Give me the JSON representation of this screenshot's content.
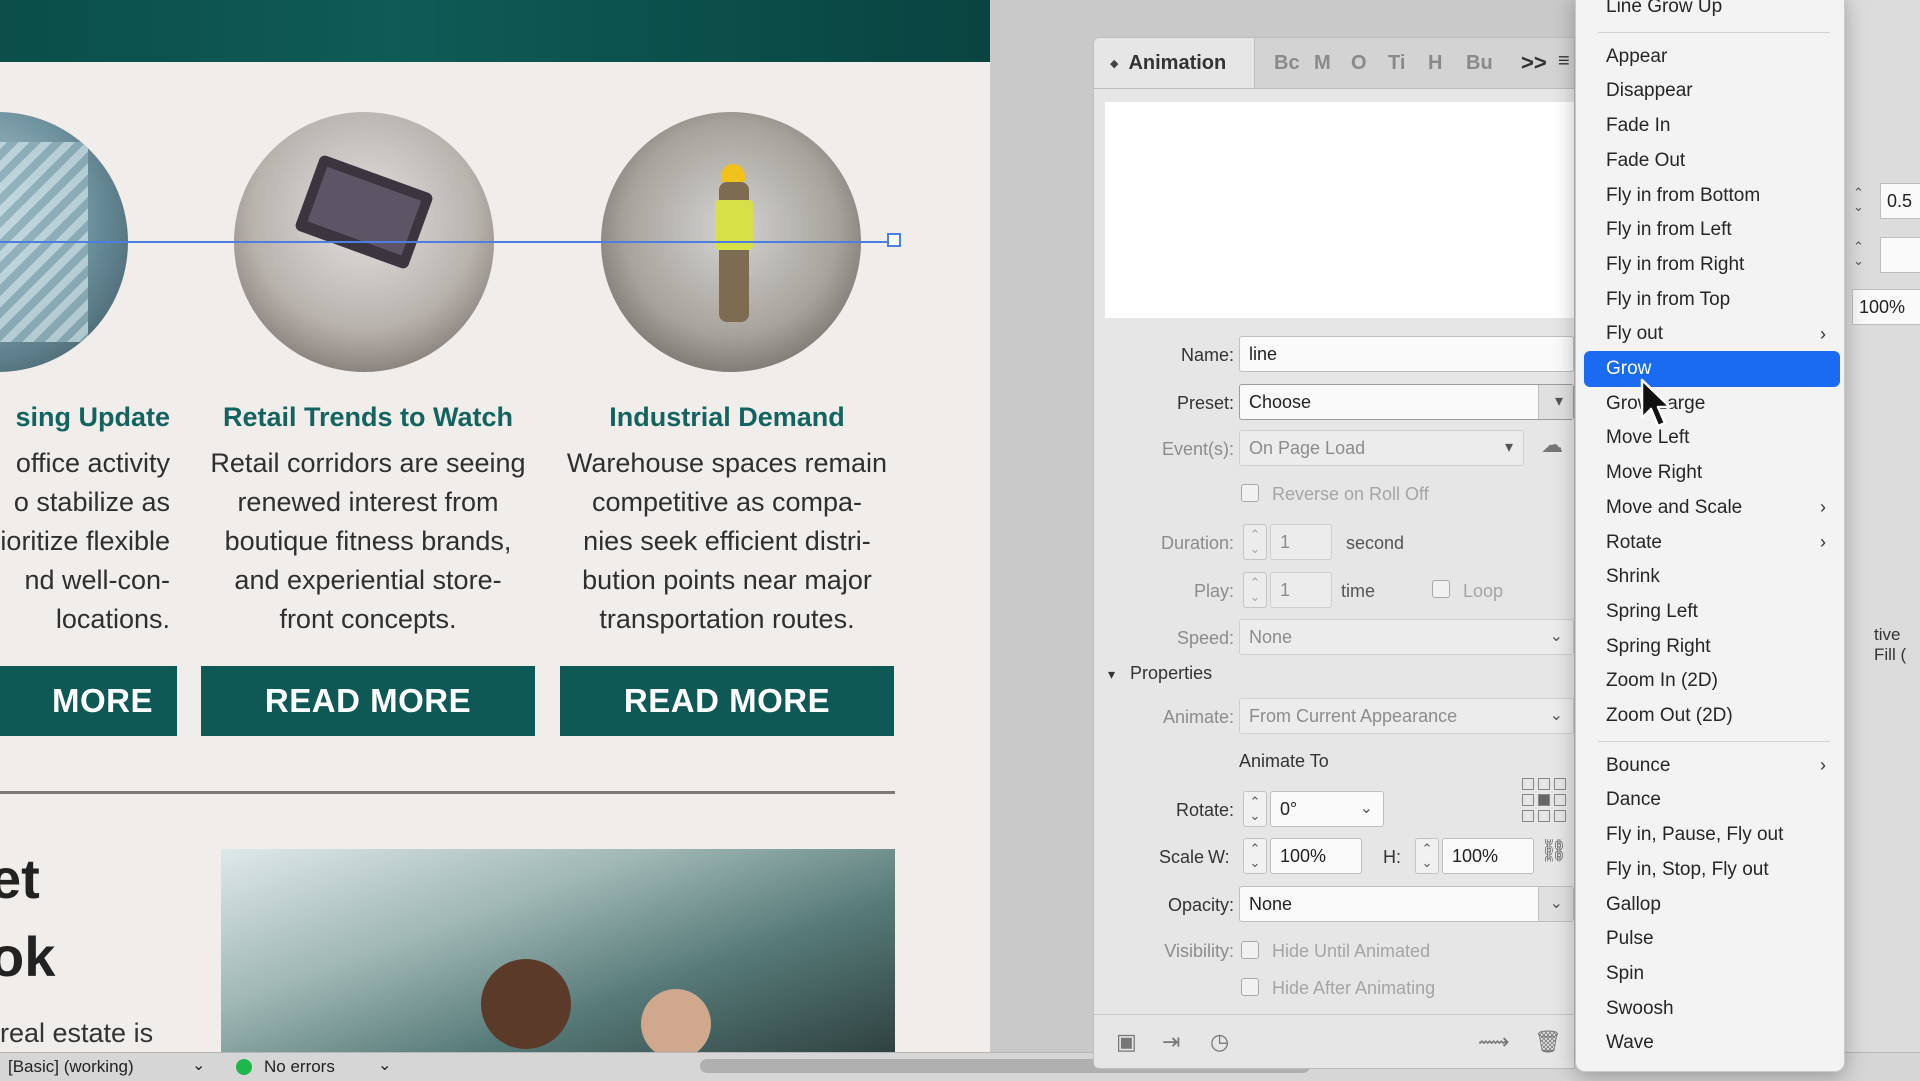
{
  "document": {
    "columns": [
      {
        "title": "sing Update",
        "body": "office activity\no stabilize as\nprioritize flexible\nnd well-con-\nlocations.",
        "button": "MORE"
      },
      {
        "title": "Retail Trends to Watch",
        "body": "Retail corridors are seeing\nrenewed interest from\nboutique fitness brands,\nand experiential store-\nfront concepts.",
        "button": "READ MORE"
      },
      {
        "title": "Industrial Demand",
        "body": "Warehouse spaces remain\ncompetitive as compa-\nnies seek efficient distri-\nbution points near major\ntransportation routes.",
        "button": "READ MORE"
      }
    ],
    "headline_line1": "et",
    "headline_line2": "ok",
    "bottom_text": "real estate is"
  },
  "status_bar": {
    "workspace": "[Basic] (working)",
    "errors": "No errors",
    "error_color": "#1db74c"
  },
  "panel": {
    "title": "Animation",
    "mini_tabs": [
      "Bc",
      "M",
      "O",
      "Ti",
      "H",
      "Bu"
    ],
    "more": ">>",
    "name_label": "Name:",
    "name_value": "line",
    "preset_label": "Preset:",
    "preset_value": "Choose",
    "events_label": "Event(s):",
    "events_value": "On Page Load",
    "reverse_label": "Reverse on Roll Off",
    "duration_label": "Duration:",
    "duration_value": "1",
    "duration_unit": "second",
    "play_label": "Play:",
    "play_value": "1",
    "play_unit": "time",
    "loop_label": "Loop",
    "speed_label": "Speed:",
    "speed_value": "None",
    "properties_label": "Properties",
    "animate_label": "Animate:",
    "animate_value": "From Current Appearance",
    "animate_to_label": "Animate To",
    "rotate_label": "Rotate:",
    "rotate_value": "0°",
    "scale_label": "Scale",
    "w_label": "W:",
    "w_value": "100%",
    "h_label": "H:",
    "h_value": "100%",
    "opacity_label": "Opacity:",
    "opacity_value": "None",
    "visibility_label": "Visibility:",
    "hide_until_label": "Hide Until Animated",
    "hide_after_label": "Hide After Animating"
  },
  "right_panel": {
    "value1": "0.5",
    "value2": "100%",
    "fill_label": "tive Fill ("
  },
  "preset_menu": {
    "selected": "Grow",
    "accent": "#1a6bf2",
    "group1": [
      {
        "label": "Line Grow Up",
        "submenu": false
      }
    ],
    "group2": [
      {
        "label": "Appear",
        "submenu": false
      },
      {
        "label": "Disappear",
        "submenu": false
      },
      {
        "label": "Fade In",
        "submenu": false
      },
      {
        "label": "Fade Out",
        "submenu": false
      },
      {
        "label": "Fly in from Bottom",
        "submenu": false
      },
      {
        "label": "Fly in from Left",
        "submenu": false
      },
      {
        "label": "Fly in from Right",
        "submenu": false
      },
      {
        "label": "Fly in from Top",
        "submenu": false
      },
      {
        "label": "Fly out",
        "submenu": true
      },
      {
        "label": "Grow",
        "submenu": false
      },
      {
        "label": "Grow Large",
        "submenu": false
      },
      {
        "label": "Move Left",
        "submenu": false
      },
      {
        "label": "Move Right",
        "submenu": false
      },
      {
        "label": "Move and Scale",
        "submenu": true
      },
      {
        "label": "Rotate",
        "submenu": true
      },
      {
        "label": "Shrink",
        "submenu": false
      },
      {
        "label": "Spring Left",
        "submenu": false
      },
      {
        "label": "Spring Right",
        "submenu": false
      },
      {
        "label": "Zoom In (2D)",
        "submenu": false
      },
      {
        "label": "Zoom Out (2D)",
        "submenu": false
      }
    ],
    "group3": [
      {
        "label": "Bounce",
        "submenu": true
      },
      {
        "label": "Dance",
        "submenu": false
      },
      {
        "label": "Fly in, Pause, Fly out",
        "submenu": false
      },
      {
        "label": "Fly in, Stop, Fly out",
        "submenu": false
      },
      {
        "label": "Gallop",
        "submenu": false
      },
      {
        "label": "Pulse",
        "submenu": false
      },
      {
        "label": "Spin",
        "submenu": false
      },
      {
        "label": "Swoosh",
        "submenu": false
      },
      {
        "label": "Wave",
        "submenu": false
      }
    ]
  }
}
